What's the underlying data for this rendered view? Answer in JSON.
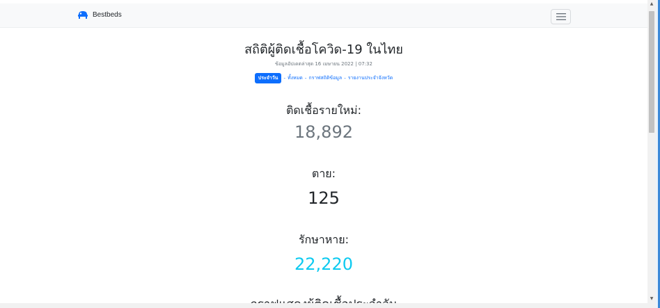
{
  "navbar": {
    "brand": "Bestbeds",
    "brand_icon": "bed-icon",
    "menu_icon": "hamburger-menu-icon"
  },
  "page": {
    "title": "สถิติผู้ติดเชื้อโควิด-19 ในไทย",
    "updated": "ข้อมูลอัปเดตล่าสุด 16 เมษายน 2022 | 07:32",
    "links": {
      "badge": "ประจำวัน",
      "separator": "-",
      "all": "ทั้งหมด",
      "charts": "กราฟสถิติข้อมูล",
      "provinces": "รายงานประจำจังหวัด"
    }
  },
  "stats": {
    "new_cases_label": "ติดเชื้อรายใหม่:",
    "new_cases_value": "18,892",
    "deaths_label": "ตาย:",
    "deaths_value": "125",
    "recovered_label": "รักษาหาย:",
    "recovered_value": "22,220"
  },
  "section": {
    "chart_title": "กราฟแสดงผู้ติดเชื้อประจำวัน"
  },
  "colors": {
    "primary": "#0d6efd",
    "new_cases": "#6c757d",
    "recovered": "#0dcaf0"
  }
}
